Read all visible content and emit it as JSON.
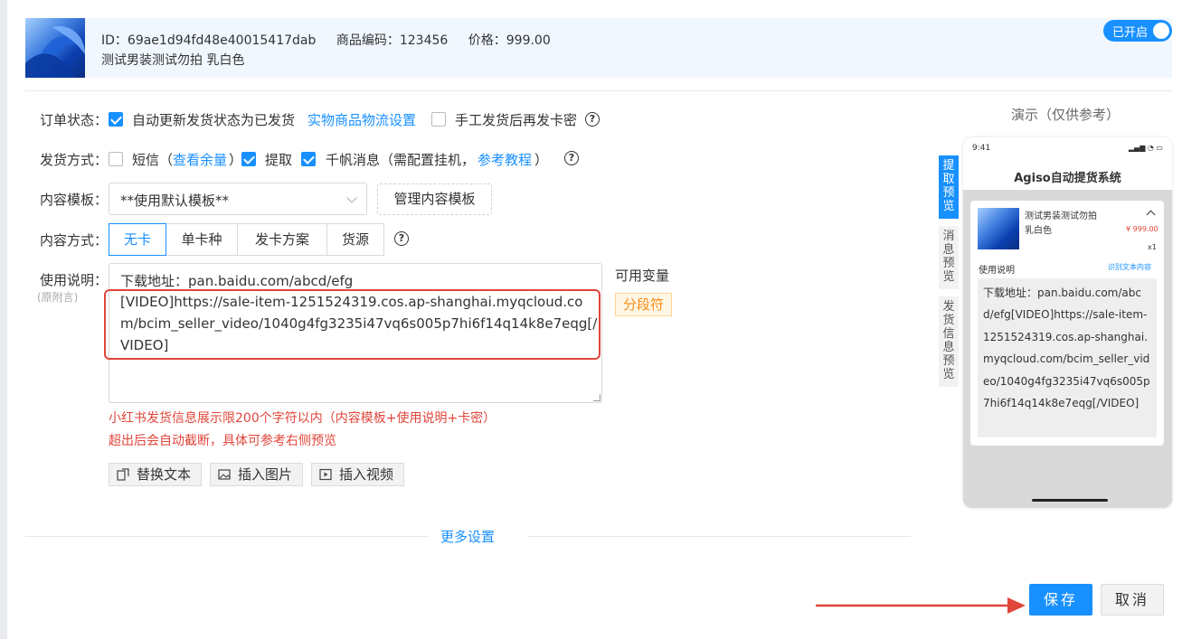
{
  "product": {
    "id_text": "ID：69ae1d94fd48e40015417dab",
    "code_text": "商品编码：123456",
    "price_text": "价格：999.00",
    "name": "测试男装测试勿拍 乳白色",
    "toggle_label": "已开启"
  },
  "form": {
    "order_status": {
      "label": "订单状态：",
      "auto_update_label": "自动更新发货状态为已发货",
      "logistics_link": "实物商品物流设置",
      "manual_label": "手工发货后再发卡密"
    },
    "delivery_method": {
      "label": "发货方式：",
      "sms_label": "短信（",
      "sms_link": "查看余量",
      "sms_close": "）",
      "extract_label": "提取",
      "qianfan_label": "千帆消息（需配置挂机，",
      "tutorial_link": "参考教程",
      "tutorial_close": "）"
    },
    "content_template": {
      "label": "内容模板：",
      "selected": "**使用默认模板**",
      "manage_button": "管理内容模板"
    },
    "content_mode": {
      "label": "内容方式：",
      "options": [
        "无卡",
        "单卡种",
        "发卡方案",
        "货源"
      ],
      "selected": "无卡"
    },
    "instructions": {
      "label": "使用说明：",
      "sub_label": "(原附言)",
      "line1": "下载地址：pan.baidu.com/abcd/efg",
      "video_text": "[VIDEO]https://sale-item-1251524319.cos.ap-shanghai.myqcloud.com/bcim_seller_video/1040g4fg3235i47vq6s005p7hi6f14q14k8e7eqg[/VIDEO]",
      "variables_title": "可用变量",
      "variable_tag": "分段符",
      "warning_line1": "小红书发货信息展示限200个字符以内（内容模板+使用说明+卡密）",
      "warning_line2": "超出后会自动截断，具体可参考右侧预览",
      "tools": [
        "替换文本",
        "插入图片",
        "插入视频"
      ]
    },
    "more_settings": "更多设置"
  },
  "preview": {
    "title": "演示（仅供参考）",
    "tabs": [
      "提取预览",
      "消息预览",
      "发货信息预览"
    ],
    "active_tab": "提取预览",
    "phone_time": "9:41",
    "app_title": "Agiso自动提货系统",
    "product_name": "测试男装测试勿拍 乳白色",
    "price": "¥ 999.00",
    "qty": "x1",
    "usage_label": "使用说明",
    "ocr_link": "识别文本内容",
    "content": "下载地址：pan.baidu.com/abcd/efg[VIDEO]https://sale-item-1251524319.cos.ap-shanghai.myqcloud.com/bcim_seller_video/1040g4fg3235i47vq6s005p7hi6f14q14k8e7eqg[/VIDEO]"
  },
  "actions": {
    "save": "保存",
    "cancel": "取消"
  },
  "colors": {
    "primary": "#1890ff",
    "danger": "#e0463a",
    "tag_orange": "#fa8c16"
  }
}
